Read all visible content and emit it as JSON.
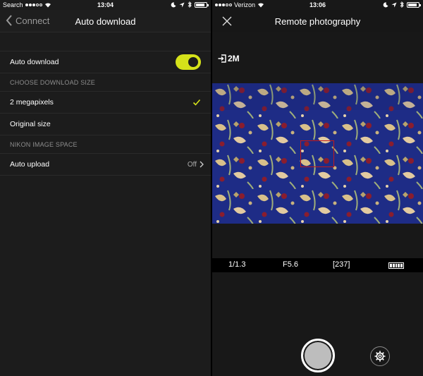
{
  "left": {
    "status": {
      "carrier": "Search",
      "time": "13:04"
    },
    "nav": {
      "back_label": "Connect",
      "title": "Auto download"
    },
    "rows": {
      "auto_download": {
        "label": "Auto download",
        "enabled": true
      },
      "section_download_size": "CHOOSE DOWNLOAD SIZE",
      "size_2mp": {
        "label": "2 megapixels",
        "selected": true
      },
      "size_original": {
        "label": "Original size",
        "selected": false
      },
      "section_nis": "NIKON IMAGE SPACE",
      "auto_upload": {
        "label": "Auto upload",
        "value": "Off"
      }
    },
    "colors": {
      "accent": "#d5e21a"
    }
  },
  "right": {
    "status": {
      "carrier": "Verizon",
      "time": "13:06"
    },
    "nav": {
      "title": "Remote photography"
    },
    "image_size": "2M",
    "exif": {
      "shutter": "1/1.3",
      "aperture": "F5.6",
      "shots_remaining": "[237]"
    },
    "icons": [
      "close-icon",
      "import-icon",
      "shutter-button",
      "gear-icon",
      "battery-icon"
    ],
    "colors": {
      "focus_frame": "#c21a1a"
    }
  }
}
